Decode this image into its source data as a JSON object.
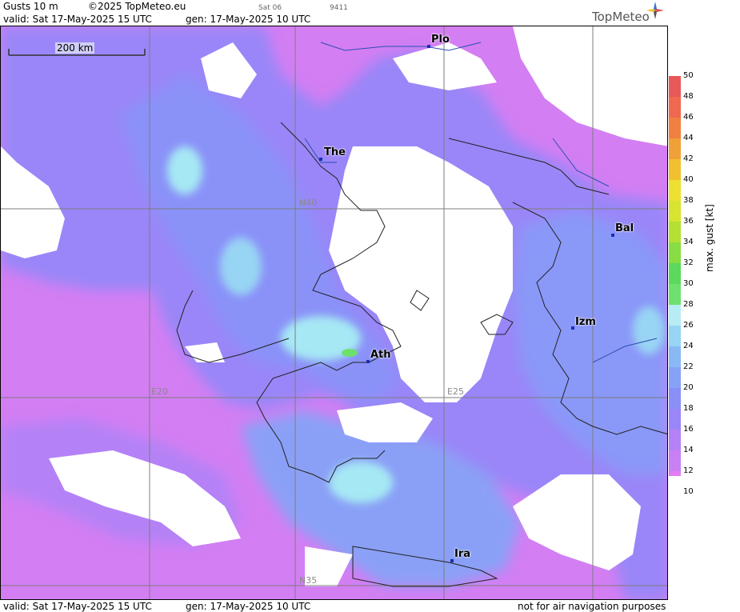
{
  "header": {
    "product": "Gusts 10 m",
    "copyright": "©2025 TopMeteo.eu",
    "satellite": "Sat 06",
    "code": "9411",
    "valid": "valid:  Sat  17-May-2025  15 UTC",
    "gen": "gen: 17-May-2025 10 UTC"
  },
  "brand": {
    "name": "TopMeteo",
    "logo_icon": "compass-star-icon"
  },
  "map": {
    "scale_label": "200 km",
    "cities": [
      {
        "code": "Plo"
      },
      {
        "code": "The"
      },
      {
        "code": "Bal"
      },
      {
        "code": "Izm"
      },
      {
        "code": "Ath"
      },
      {
        "code": "Ira"
      }
    ],
    "grid_labels": [
      "N40",
      "E20",
      "E25",
      "N35"
    ]
  },
  "legend": {
    "unit": "max. gust  [kt]",
    "ticks": [
      "50",
      "48",
      "46",
      "44",
      "42",
      "40",
      "38",
      "36",
      "34",
      "32",
      "30",
      "28",
      "26",
      "24",
      "22",
      "20",
      "18",
      "16",
      "14",
      "12",
      "10"
    ],
    "colors": {
      "12": "#e07ef0",
      "14": "#c880f4",
      "16": "#b482f6",
      "18": "#9a86f8",
      "20": "#8a8ff8",
      "22": "#86a2f6",
      "24": "#8ab8f4",
      "26": "#98d4f4",
      "28": "#b8ecf4",
      "30": "#6ee06e",
      "32": "#5cd85c",
      "34": "#88dc44",
      "36": "#b4e034",
      "38": "#d8e430",
      "40": "#ece030",
      "42": "#f0c030",
      "44": "#f0a038",
      "46": "#f08040",
      "48": "#f06850",
      "50": "#e85858"
    }
  },
  "footer": {
    "valid": "valid:  Sat  17-May-2025  15 UTC",
    "gen": "gen: 17-May-2025 10 UTC",
    "disclaimer": "not for air navigation purposes"
  }
}
